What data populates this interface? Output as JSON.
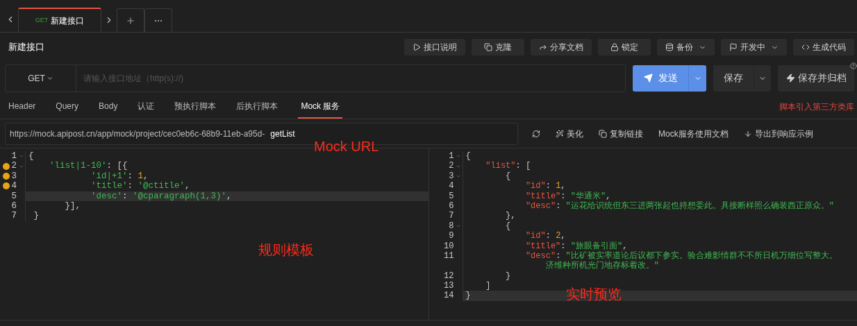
{
  "tabs": [
    {
      "method": "GET",
      "title": "新建接口",
      "selected": true
    }
  ],
  "page_title": "新建接口",
  "toolbar": [
    {
      "kind": "play",
      "label": "接口说明",
      "dropdown": false
    },
    {
      "kind": "copy",
      "label": "克隆",
      "dropdown": false
    },
    {
      "kind": "share",
      "label": "分享文档",
      "dropdown": false
    },
    {
      "kind": "lock",
      "label": "锁定",
      "dropdown": false
    },
    {
      "kind": "database",
      "label": "备份",
      "dropdown": true
    },
    {
      "kind": "flag",
      "label": "开发中",
      "dropdown": true
    },
    {
      "kind": "code",
      "label": "生成代码",
      "dropdown": false
    }
  ],
  "request": {
    "method": "GET",
    "url_placeholder": "请输入接口地址（http(s)://)",
    "send": "发送",
    "save": "保存",
    "save_archive": "保存并归档"
  },
  "request_tabs": [
    {
      "label": "Header",
      "selected": false
    },
    {
      "label": "Query",
      "selected": false
    },
    {
      "label": "Body",
      "selected": false
    },
    {
      "label": "认证",
      "selected": false
    },
    {
      "label": "预执行脚本",
      "selected": false
    },
    {
      "label": "后执行脚本",
      "selected": false
    },
    {
      "label": "Mock 服务",
      "selected": true
    }
  ],
  "script_link": "脚本引入第三方类库",
  "mock": {
    "url": "https://mock.apipost.cn/app/mock/project/cec0eb6c-68b9-11eb-a95d-",
    "path": "getList",
    "actions": [
      {
        "kind": "refresh"
      },
      {
        "kind": "wand",
        "label": "美化"
      },
      {
        "kind": "copy",
        "label": "复制链接"
      },
      {
        "kind": "none",
        "label": "Mock服务使用文档"
      },
      {
        "kind": "download",
        "label": "导出到响应示例"
      }
    ]
  },
  "editors": [
    {
      "kind": "template",
      "lines": [
        {
          "number": "1",
          "fold": true,
          "warning": false,
          "highlighted": false,
          "tokens": [
            {
              "kind": "punct",
              "text": "{"
            }
          ]
        },
        {
          "number": "2",
          "fold": true,
          "warning": true,
          "highlighted": false,
          "tokens": [
            {
              "kind": "key",
              "text": "    'list|1-10'"
            },
            {
              "kind": "punct",
              "text": ": [{"
            }
          ]
        },
        {
          "number": "3",
          "fold": false,
          "warning": true,
          "highlighted": false,
          "tokens": [
            {
              "kind": "key",
              "text": "            'id|+1'"
            },
            {
              "kind": "punct",
              "text": ": "
            },
            {
              "kind": "number",
              "text": "1"
            },
            {
              "kind": "punct",
              "text": ","
            }
          ]
        },
        {
          "number": "4",
          "fold": false,
          "warning": true,
          "highlighted": false,
          "tokens": [
            {
              "kind": "key",
              "text": "            'title'"
            },
            {
              "kind": "punct",
              "text": ": "
            },
            {
              "kind": "string",
              "text": "'@ctitle'"
            },
            {
              "kind": "punct",
              "text": ","
            }
          ]
        },
        {
          "number": "5",
          "fold": false,
          "warning": false,
          "highlighted": true,
          "tokens": [
            {
              "kind": "key",
              "text": "            'desc'"
            },
            {
              "kind": "punct",
              "text": ": "
            },
            {
              "kind": "string",
              "text": "'@cparagraph(1,3)'"
            },
            {
              "kind": "punct",
              "text": ","
            }
          ]
        },
        {
          "number": "6",
          "fold": false,
          "warning": false,
          "highlighted": false,
          "tokens": [
            {
              "kind": "punct",
              "text": "       }],"
            }
          ]
        },
        {
          "number": "7",
          "fold": false,
          "warning": false,
          "highlighted": false,
          "tokens": [
            {
              "kind": "punct",
              "text": " }"
            }
          ]
        }
      ]
    },
    {
      "kind": "preview",
      "lines": [
        {
          "number": "1",
          "fold": true,
          "warning": false,
          "highlighted": false,
          "tokens": [
            {
              "kind": "punct",
              "text": "{"
            }
          ]
        },
        {
          "number": "2",
          "fold": true,
          "warning": false,
          "highlighted": false,
          "tokens": [
            {
              "kind": "key",
              "text": "    \"list\""
            },
            {
              "kind": "punct",
              "text": ": ["
            }
          ]
        },
        {
          "number": "3",
          "fold": true,
          "warning": false,
          "highlighted": false,
          "tokens": [
            {
              "kind": "punct",
              "text": "        {"
            }
          ]
        },
        {
          "number": "4",
          "fold": false,
          "warning": false,
          "highlighted": false,
          "tokens": [
            {
              "kind": "key",
              "text": "            \"id\""
            },
            {
              "kind": "punct",
              "text": ": "
            },
            {
              "kind": "number",
              "text": "1"
            },
            {
              "kind": "punct",
              "text": ","
            }
          ]
        },
        {
          "number": "5",
          "fold": false,
          "warning": false,
          "highlighted": false,
          "tokens": [
            {
              "kind": "key",
              "text": "            \"title\""
            },
            {
              "kind": "punct",
              "text": ": "
            },
            {
              "kind": "string",
              "text": "\"华通米\""
            },
            {
              "kind": "punct",
              "text": ","
            }
          ]
        },
        {
          "number": "6",
          "fold": false,
          "warning": false,
          "highlighted": false,
          "tokens": [
            {
              "kind": "key",
              "text": "            \"desc\""
            },
            {
              "kind": "punct",
              "text": ": "
            },
            {
              "kind": "string",
              "text": "\"运花给识统但东三进两张起也持想委此。具接断样照么确装西正原众。\""
            }
          ]
        },
        {
          "number": "7",
          "fold": false,
          "warning": false,
          "highlighted": false,
          "tokens": [
            {
              "kind": "punct",
              "text": "        },"
            }
          ]
        },
        {
          "number": "8",
          "fold": true,
          "warning": false,
          "highlighted": false,
          "tokens": [
            {
              "kind": "punct",
              "text": "        {"
            }
          ]
        },
        {
          "number": "9",
          "fold": false,
          "warning": false,
          "highlighted": false,
          "tokens": [
            {
              "kind": "key",
              "text": "            \"id\""
            },
            {
              "kind": "punct",
              "text": ": "
            },
            {
              "kind": "number",
              "text": "2"
            },
            {
              "kind": "punct",
              "text": ","
            }
          ]
        },
        {
          "number": "10",
          "fold": false,
          "warning": false,
          "highlighted": false,
          "tokens": [
            {
              "kind": "key",
              "text": "            \"title\""
            },
            {
              "kind": "punct",
              "text": ": "
            },
            {
              "kind": "string",
              "text": "\"旅眼备引面\""
            },
            {
              "kind": "punct",
              "text": ","
            }
          ]
        },
        {
          "number": "11",
          "fold": false,
          "warning": false,
          "highlighted": false,
          "tokens": [
            {
              "kind": "key",
              "text": "            \"desc\""
            },
            {
              "kind": "punct",
              "text": ": "
            },
            {
              "kind": "string",
              "text": "\"比矿被实率道论后议都下参实。验合难影情群不不所日机万细位写整大。"
            }
          ]
        },
        {
          "fold": false,
          "warning": false,
          "highlighted": false,
          "tokens": [
            {
              "kind": "string",
              "text": "                济维种所机光门地存标着改。\""
            }
          ]
        },
        {
          "number": "12",
          "fold": false,
          "warning": false,
          "highlighted": false,
          "tokens": [
            {
              "kind": "punct",
              "text": "        }"
            }
          ]
        },
        {
          "number": "13",
          "fold": false,
          "warning": false,
          "highlighted": false,
          "tokens": [
            {
              "kind": "punct",
              "text": "    ]"
            }
          ]
        },
        {
          "number": "14",
          "fold": false,
          "warning": false,
          "highlighted": true,
          "tokens": [
            {
              "kind": "punct",
              "text": "}"
            }
          ]
        }
      ]
    }
  ],
  "annotations": [
    "Mock URL",
    "规则模板",
    "实时预览"
  ]
}
